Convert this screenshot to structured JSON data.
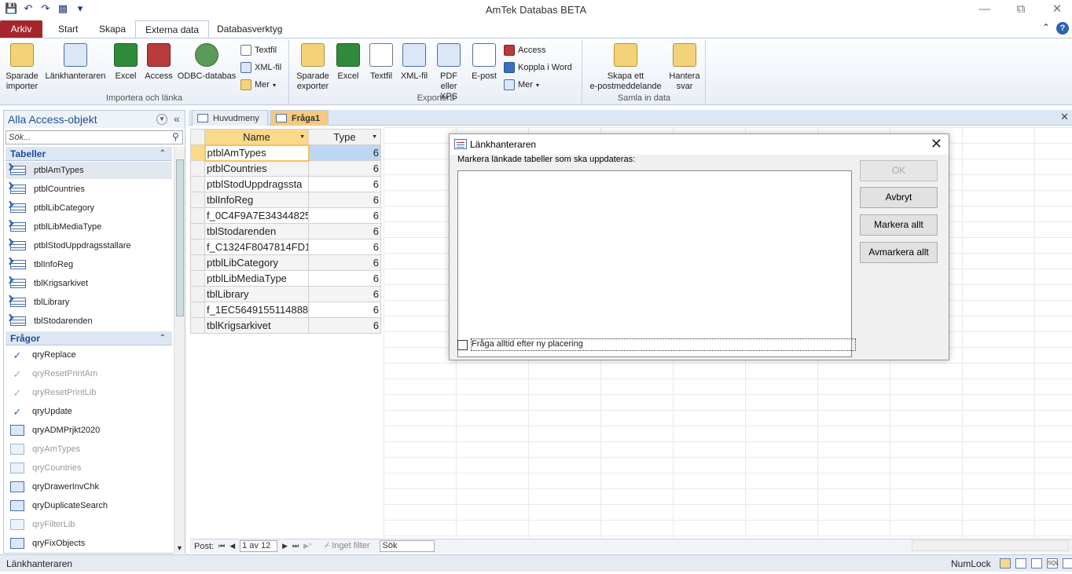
{
  "window": {
    "title": "AmTek Databas BETA"
  },
  "ribbon_tabs": [
    {
      "label": "Arkiv"
    },
    {
      "label": "Start"
    },
    {
      "label": "Skapa"
    },
    {
      "label": "Externa data"
    },
    {
      "label": "Databasverktyg"
    }
  ],
  "ribbon": {
    "import_group": {
      "label": "Importera och länka",
      "buttons": [
        "Sparade\nimporter",
        "Länkhanteraren",
        "Excel",
        "Access",
        "ODBC-databas"
      ],
      "small": [
        "Textfil",
        "XML-fil",
        "Mer"
      ]
    },
    "export_group": {
      "label": "Exportera",
      "buttons": [
        "Sparade\nexporter",
        "Excel",
        "Textfil",
        "XML-fil",
        "PDF\neller XPS",
        "E-post"
      ],
      "small": [
        "Access",
        "Koppla i Word",
        "Mer"
      ]
    },
    "collect_group": {
      "label": "Samla in data",
      "buttons": [
        "Skapa ett\ne-postmeddelande",
        "Hantera\nsvar"
      ]
    }
  },
  "nav_pane": {
    "title": "Alla Access-objekt",
    "search_placeholder": "Sök...",
    "sections": [
      {
        "label": "Tabeller",
        "items": [
          "ptblAmTypes",
          "ptblCountries",
          "ptblLibCategory",
          "ptblLibMediaType",
          "ptblStodUppdragsstallare",
          "tblInfoReg",
          "tblKrigsarkivet",
          "tblLibrary",
          "tblStodarenden"
        ]
      },
      {
        "label": "Frågor",
        "items": [
          "qryReplace",
          "qryResetPrintAm",
          "qryResetPrintLib",
          "qryUpdate",
          "qryADMPrjkt2020",
          "qryAmTypes",
          "qryCountries",
          "qryDrawerInvChk",
          "qryDuplicateSearch",
          "qryFilterLib",
          "qryFixObjects"
        ]
      }
    ]
  },
  "doc_tabs": [
    {
      "label": "Huvudmeny"
    },
    {
      "label": "Fråga1"
    }
  ],
  "datasheet": {
    "columns": [
      "Name",
      "Type"
    ],
    "rows": [
      [
        "ptblAmTypes",
        "6"
      ],
      [
        "ptblCountries",
        "6"
      ],
      [
        "ptblStodUppdragssta",
        "6"
      ],
      [
        "tblInfoReg",
        "6"
      ],
      [
        "f_0C4F9A7E34344825",
        "6"
      ],
      [
        "tblStodarenden",
        "6"
      ],
      [
        "f_C1324F8047814FD1",
        "6"
      ],
      [
        "ptblLibCategory",
        "6"
      ],
      [
        "ptblLibMediaType",
        "6"
      ],
      [
        "tblLibrary",
        "6"
      ],
      [
        "f_1EC5649155114888",
        "6"
      ],
      [
        "tblKrigsarkivet",
        "6"
      ]
    ]
  },
  "record_nav": {
    "label": "Post:",
    "counter": "1 av 12",
    "filter": "Inget filter",
    "search": "Sök"
  },
  "status_bar": {
    "left": "Länkhanteraren",
    "numlock": "NumLock"
  },
  "dialog": {
    "title": "Länkhanteraren",
    "instruction": "Markera länkade tabeller som ska uppdateras:",
    "buttons": {
      "ok": "OK",
      "cancel": "Avbryt",
      "select_all": "Markera allt",
      "deselect_all": "Avmarkera allt"
    },
    "checkbox_label": "Fråga alltid efter ny placering"
  }
}
